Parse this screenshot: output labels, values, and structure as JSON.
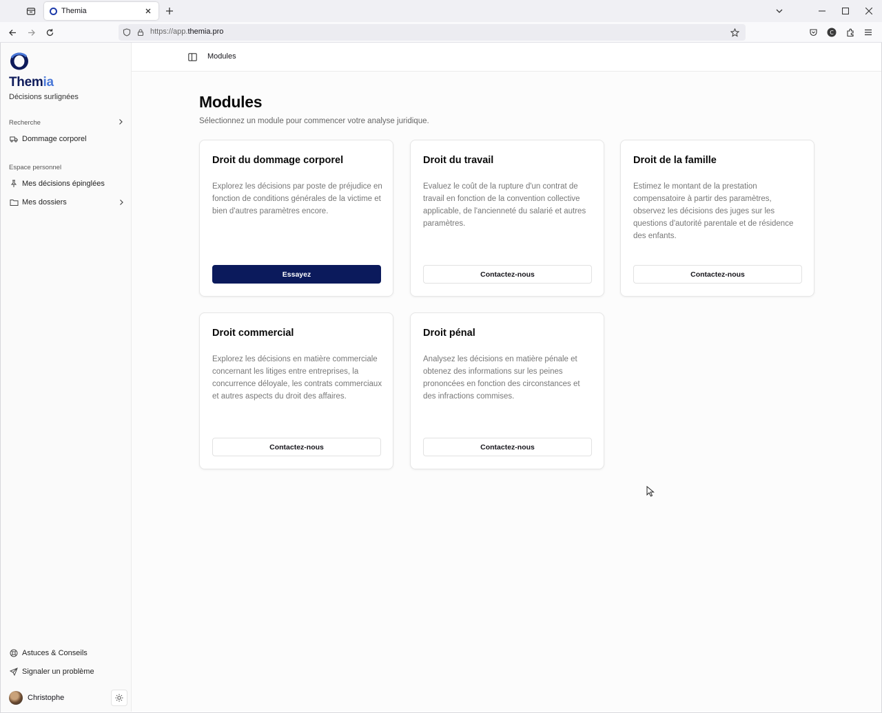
{
  "browser": {
    "tab_title": "Themia",
    "url_prefix": "https://app.",
    "url_domain": "themia.pro"
  },
  "sidebar": {
    "brand_main": "Them",
    "brand_accent": "ia",
    "tagline": "Décisions surlignées",
    "group_search": "Recherche",
    "item_dommage": "Dommage corporel",
    "group_personal": "Espace personnel",
    "item_pinned": "Mes décisions épinglées",
    "item_folders": "Mes dossiers",
    "item_tips": "Astuces & Conseils",
    "item_report": "Signaler un problème",
    "user_name": "Christophe"
  },
  "topbar": {
    "breadcrumb": "Modules"
  },
  "main": {
    "title": "Modules",
    "subtitle": "Sélectionnez un module pour commencer votre analyse juridique.",
    "cards": [
      {
        "title": "Droit du dommage corporel",
        "description": "Explorez les décisions par poste de préjudice en fonction de conditions générales de la victime et bien d'autres paramètres encore.",
        "button": "Essayez"
      },
      {
        "title": "Droit du travail",
        "description": "Evaluez le coût de la rupture d'un contrat de travail en fonction de la convention collective applicable, de l'ancienneté du salarié et autres paramètres.",
        "button": "Contactez-nous"
      },
      {
        "title": "Droit de la famille",
        "description": "Estimez le montant de la prestation compensatoire à partir des paramètres, observez les décisions des juges sur les questions d'autorité parentale et de résidence des enfants.",
        "button": "Contactez-nous"
      },
      {
        "title": "Droit commercial",
        "description": "Explorez les décisions en matière commerciale concernant les litiges entre entreprises, la concurrence déloyale, les contrats commerciaux et autres aspects du droit des affaires.",
        "button": "Contactez-nous"
      },
      {
        "title": "Droit pénal",
        "description": "Analysez les décisions en matière pénale et obtenez des informations sur les peines prononcées en fonction des circonstances et des infractions commises.",
        "button": "Contactez-nous"
      }
    ]
  },
  "colors": {
    "brand": "#0d1a5a",
    "brand_accent": "#4a78d8",
    "primary_button": "#0b1a5c"
  }
}
